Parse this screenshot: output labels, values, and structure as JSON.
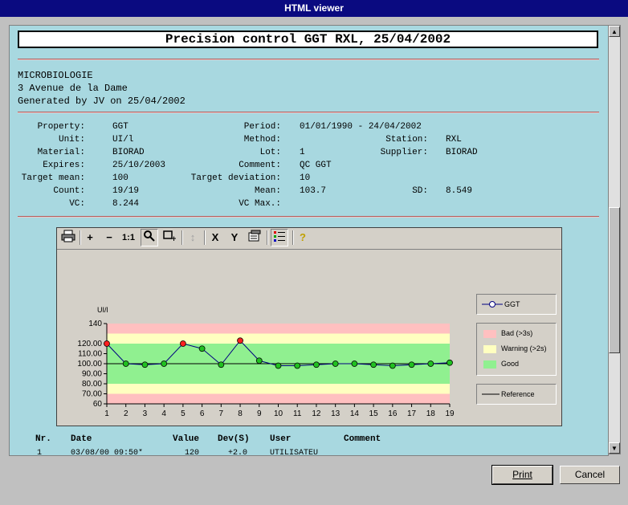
{
  "window": {
    "title": "HTML viewer"
  },
  "report": {
    "title": "Precision control GGT RXL, 25/04/2002",
    "address": [
      "MICROBIOLOGIE",
      "3 Avenue de la Dame",
      "Generated by JV on 25/04/2002"
    ],
    "properties": {
      "col1": [
        {
          "label": "Property:",
          "value": "GGT"
        },
        {
          "label": "Unit:",
          "value": "UI/l"
        },
        {
          "label": "Material:",
          "value": "BIORAD"
        },
        {
          "label": "Expires:",
          "value": "25/10/2003"
        },
        {
          "label": "Target mean:",
          "value": "100"
        },
        {
          "label": "Count:",
          "value": "19/19"
        },
        {
          "label": "VC:",
          "value": "8.244"
        }
      ],
      "col2": [
        {
          "label": "Period:",
          "value": "01/01/1990 - 24/04/2002"
        },
        {
          "label": "Method:",
          "value": ""
        },
        {
          "label": "Lot:",
          "value": "1"
        },
        {
          "label": "Comment:",
          "value": "QC GGT"
        },
        {
          "label": "Target deviation:",
          "value": "10"
        },
        {
          "label": "Mean:",
          "value": "103.7"
        },
        {
          "label": "VC Max.:",
          "value": ""
        }
      ],
      "col3": [
        {
          "label": "Station:",
          "value": "RXL"
        },
        {
          "label": "Supplier:",
          "value": "BIORAD"
        },
        {
          "label": "SD:",
          "value": "8.549"
        }
      ]
    },
    "table": {
      "headers": [
        "Nr.",
        "Date",
        "Value",
        "Dev(S)",
        "User",
        "Comment"
      ],
      "first_row": [
        "1",
        "03/08/00 09:50*",
        "120",
        "+2.0",
        "UTILISATEU",
        ""
      ]
    }
  },
  "toolbar": {
    "zoom_reset_label": "1:1",
    "x_label": "X",
    "y_label": "Y"
  },
  "legend": {
    "series": "GGT",
    "bad": "Bad (>3s)",
    "warning": "Warning (>2s)",
    "good": "Good",
    "reference": "Reference"
  },
  "colors": {
    "bad": "#ffc0c0",
    "warning": "#ffffc0",
    "good": "#90f090",
    "line": "#000080",
    "point_bad": "#ff2020",
    "point_good": "#20c020"
  },
  "chart_data": {
    "type": "line",
    "ylabel": "UI/l",
    "ylim": [
      60,
      140
    ],
    "yticks": [
      "140",
      "120.00",
      "110.00",
      "100.00",
      "90.00",
      "80.00",
      "70.00",
      "60"
    ],
    "x": [
      1,
      2,
      3,
      4,
      5,
      6,
      7,
      8,
      9,
      10,
      11,
      12,
      13,
      14,
      15,
      16,
      17,
      18,
      19
    ],
    "series": [
      {
        "name": "GGT",
        "values": [
          120,
          100,
          99,
          100,
          120,
          115,
          99,
          123,
          103,
          98,
          98,
          99,
          100,
          100,
          99,
          98,
          99,
          100,
          101
        ]
      }
    ],
    "reference": 100,
    "bands": {
      "good": [
        80,
        120
      ],
      "warning": [
        70,
        130
      ],
      "bad": [
        60,
        140
      ]
    }
  },
  "buttons": {
    "print": "Print",
    "cancel": "Cancel"
  }
}
